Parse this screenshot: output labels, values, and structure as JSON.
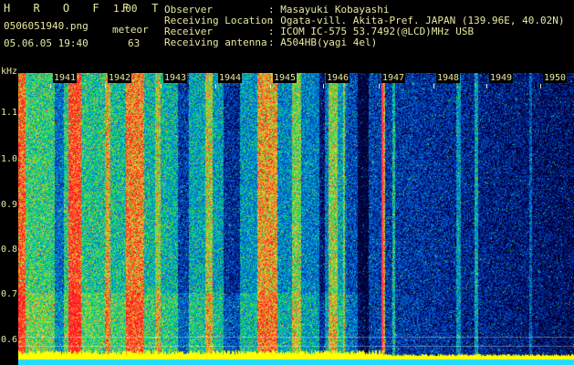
{
  "app": {
    "logo": "H R O F F T",
    "version": "1.00"
  },
  "file": {
    "name": "0506051940.png",
    "datetime": "05.06.05 19:40"
  },
  "detection": {
    "label": "meteor",
    "count": "63"
  },
  "info": {
    "observer_label": "Observer",
    "observer_value": ": Masayuki Kobayashi",
    "location_label": "Receiving Location",
    "location_value": ": Ogata-vill. Akita-Pref. JAPAN (139.96E, 40.02N)",
    "receiver_label": "Receiver",
    "receiver_value": ": ICOM IC-575 53.7492(@LCD)MHz USB",
    "antenna_label": "Receiving antenna",
    "antenna_value": ": A504HB(yagi 4el)"
  },
  "spectrogram": {
    "y_unit": "kHz",
    "y_ticks": [
      "1.1",
      "1.0",
      "0.9",
      "0.8",
      "0.7",
      "0.6"
    ],
    "x_ticks": [
      "1941",
      "1942",
      "1943",
      "1944",
      "1945",
      "1946",
      "1947",
      "1948",
      "1949",
      "1950"
    ],
    "colors": {
      "background": "#000044",
      "low": "#0033cc",
      "mid": "#00cc66",
      "high": "#ff2222",
      "baseline": "#ffff00",
      "cyan": "#22ddff"
    }
  }
}
